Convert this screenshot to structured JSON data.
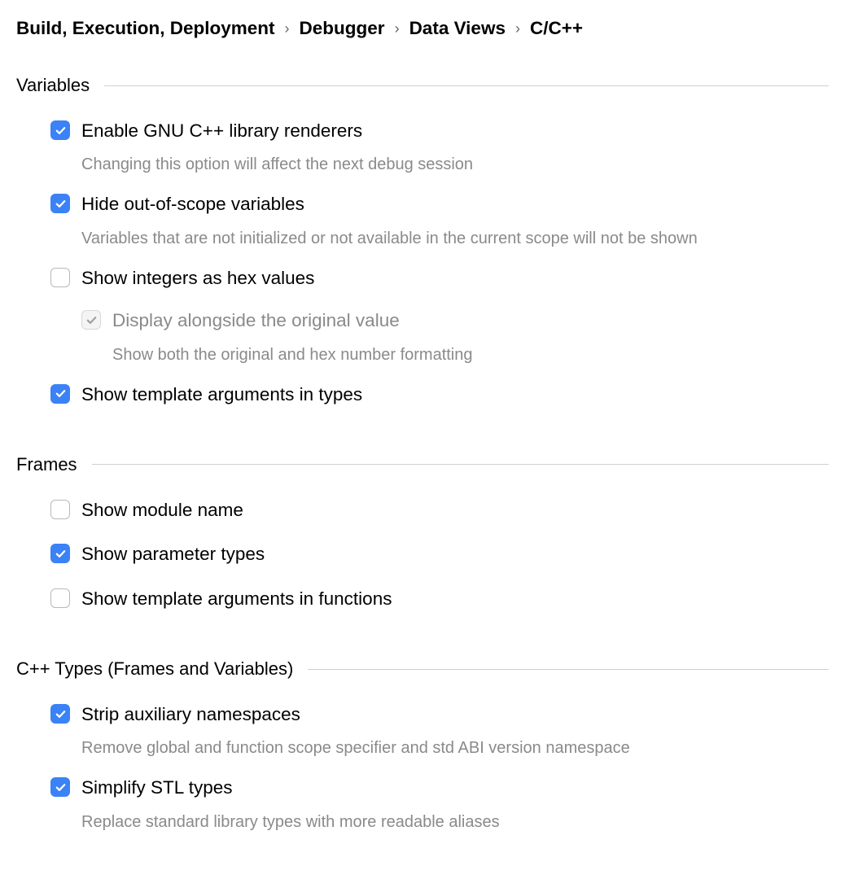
{
  "breadcrumb": {
    "items": [
      "Build, Execution, Deployment",
      "Debugger",
      "Data Views",
      "C/C++"
    ]
  },
  "sections": {
    "variables": {
      "title": "Variables",
      "opts": {
        "gnu_renderers": {
          "label": "Enable GNU C++ library renderers",
          "hint": "Changing this option will affect the next debug session",
          "checked": true
        },
        "hide_oos": {
          "label": "Hide out-of-scope variables",
          "hint": "Variables that are not initialized or not available in the current scope will not be shown",
          "checked": true
        },
        "hex": {
          "label": "Show integers as hex values",
          "checked": false
        },
        "hex_alongside": {
          "label": "Display alongside the original value",
          "hint": "Show both the original and hex number formatting",
          "checked": true,
          "disabled": true
        },
        "tmpl_types": {
          "label": "Show template arguments in types",
          "checked": true
        }
      }
    },
    "frames": {
      "title": "Frames",
      "opts": {
        "module": {
          "label": "Show module name",
          "checked": false
        },
        "param_types": {
          "label": "Show parameter types",
          "checked": true
        },
        "tmpl_funcs": {
          "label": "Show template arguments in functions",
          "checked": false
        }
      }
    },
    "cpp_types": {
      "title": "C++ Types (Frames and Variables)",
      "opts": {
        "strip_ns": {
          "label": "Strip auxiliary namespaces",
          "hint": "Remove global and function scope specifier and std ABI version namespace",
          "checked": true
        },
        "simplify_stl": {
          "label": "Simplify STL types",
          "hint": "Replace standard library types with more readable aliases",
          "checked": true
        }
      }
    }
  }
}
